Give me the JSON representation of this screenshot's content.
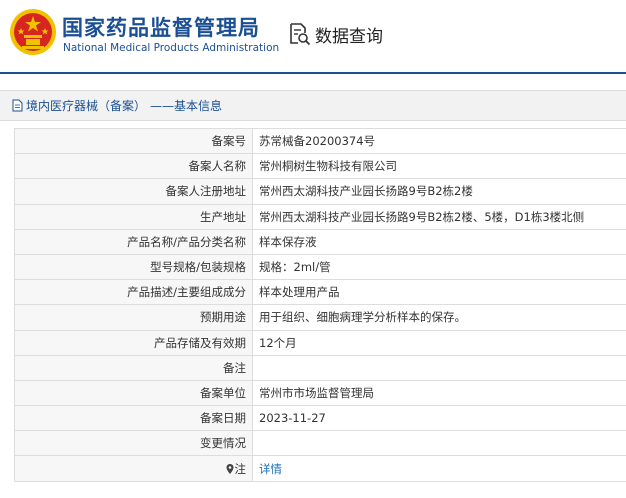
{
  "header": {
    "title_cn": "国家药品监督管理局",
    "title_en": "National Medical Products Administration",
    "search_label": "数据查询"
  },
  "breadcrumb": {
    "section": "境内医疗器械（备案）",
    "separator": "——",
    "page": "基本信息"
  },
  "colors": {
    "brand_blue": "#1b4f93",
    "emblem_red": "#d7261f",
    "emblem_gold": "#f2c100",
    "link_blue": "#1b6fb8"
  },
  "rows": [
    {
      "label": "备案号",
      "value": "苏常械备20200374号"
    },
    {
      "label": "备案人名称",
      "value": "常州桐树生物科技有限公司"
    },
    {
      "label": "备案人注册地址",
      "value": "常州西太湖科技产业园长扬路9号B2栋2楼"
    },
    {
      "label": "生产地址",
      "value": "常州西太湖科技产业园长扬路9号B2栋2楼、5楼，D1栋3楼北侧"
    },
    {
      "label": "产品名称/产品分类名称",
      "value": "样本保存液"
    },
    {
      "label": "型号规格/包装规格",
      "value": "规格：2ml/管"
    },
    {
      "label": "产品描述/主要组成成分",
      "value": "样本处理用产品"
    },
    {
      "label": "预期用途",
      "value": "用于组织、细胞病理学分析样本的保存。"
    },
    {
      "label": "产品存储及有效期",
      "value": "12个月"
    },
    {
      "label": "备注",
      "value": ""
    },
    {
      "label": "备案单位",
      "value": "常州市市场监督管理局"
    },
    {
      "label": "备案日期",
      "value": "2023-11-27"
    },
    {
      "label": "变更情况",
      "value": ""
    },
    {
      "label": "注",
      "value": "详情"
    }
  ]
}
